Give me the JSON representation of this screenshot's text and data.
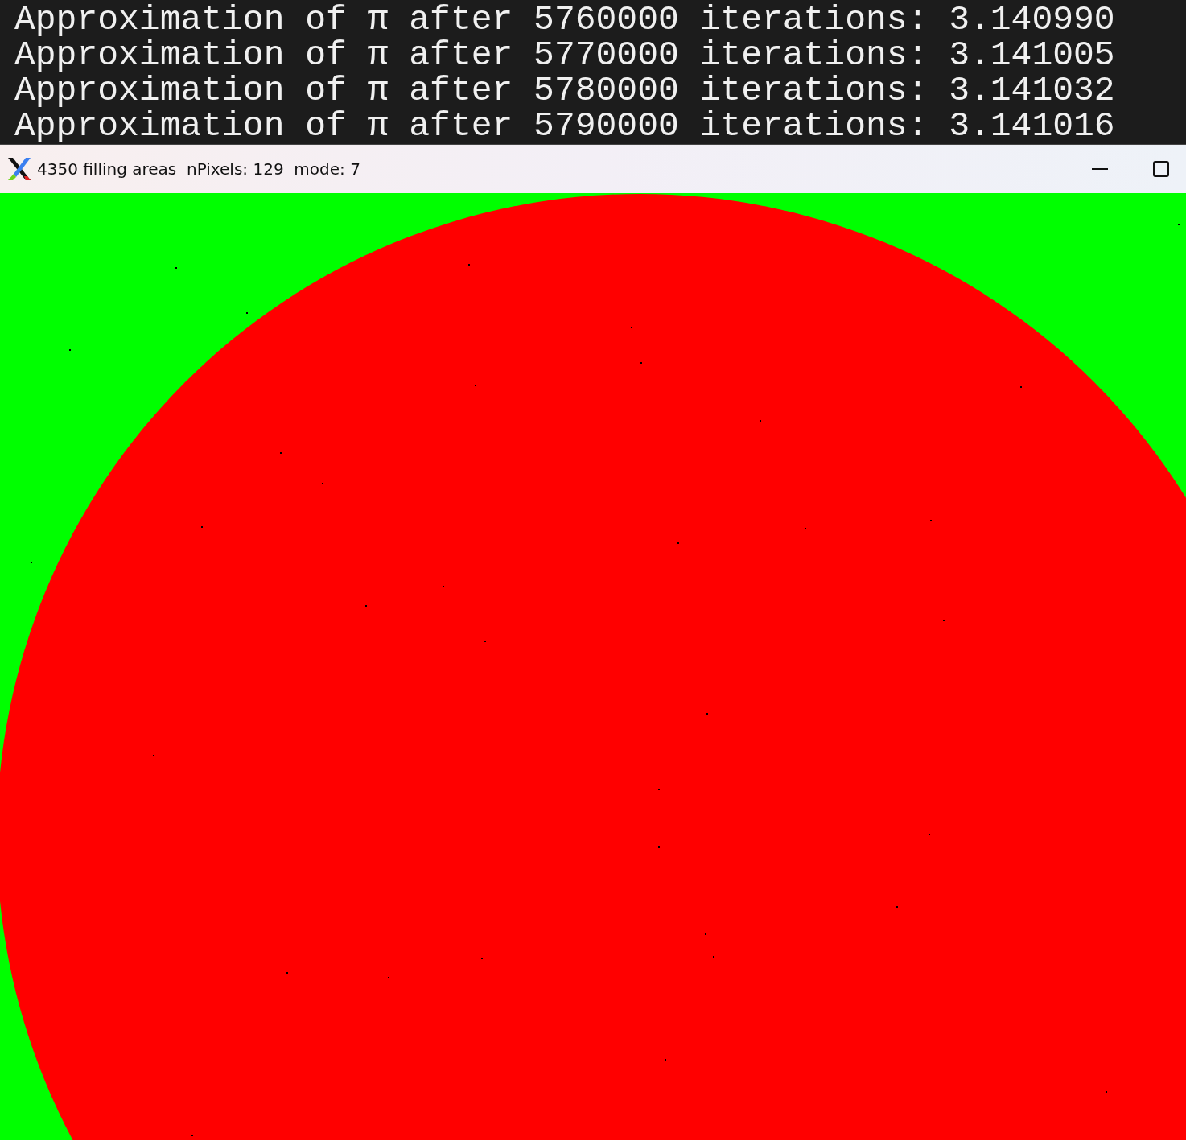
{
  "terminal": {
    "lines": [
      "Approximation of π after 5760000 iterations: 3.140990",
      "Approximation of π after 5770000 iterations: 3.141005",
      "Approximation of π after 5780000 iterations: 3.141032",
      "Approximation of π after 5790000 iterations: 3.141016"
    ]
  },
  "window": {
    "title": "4350 filling areas  nPixels: 129  mode: 7"
  }
}
